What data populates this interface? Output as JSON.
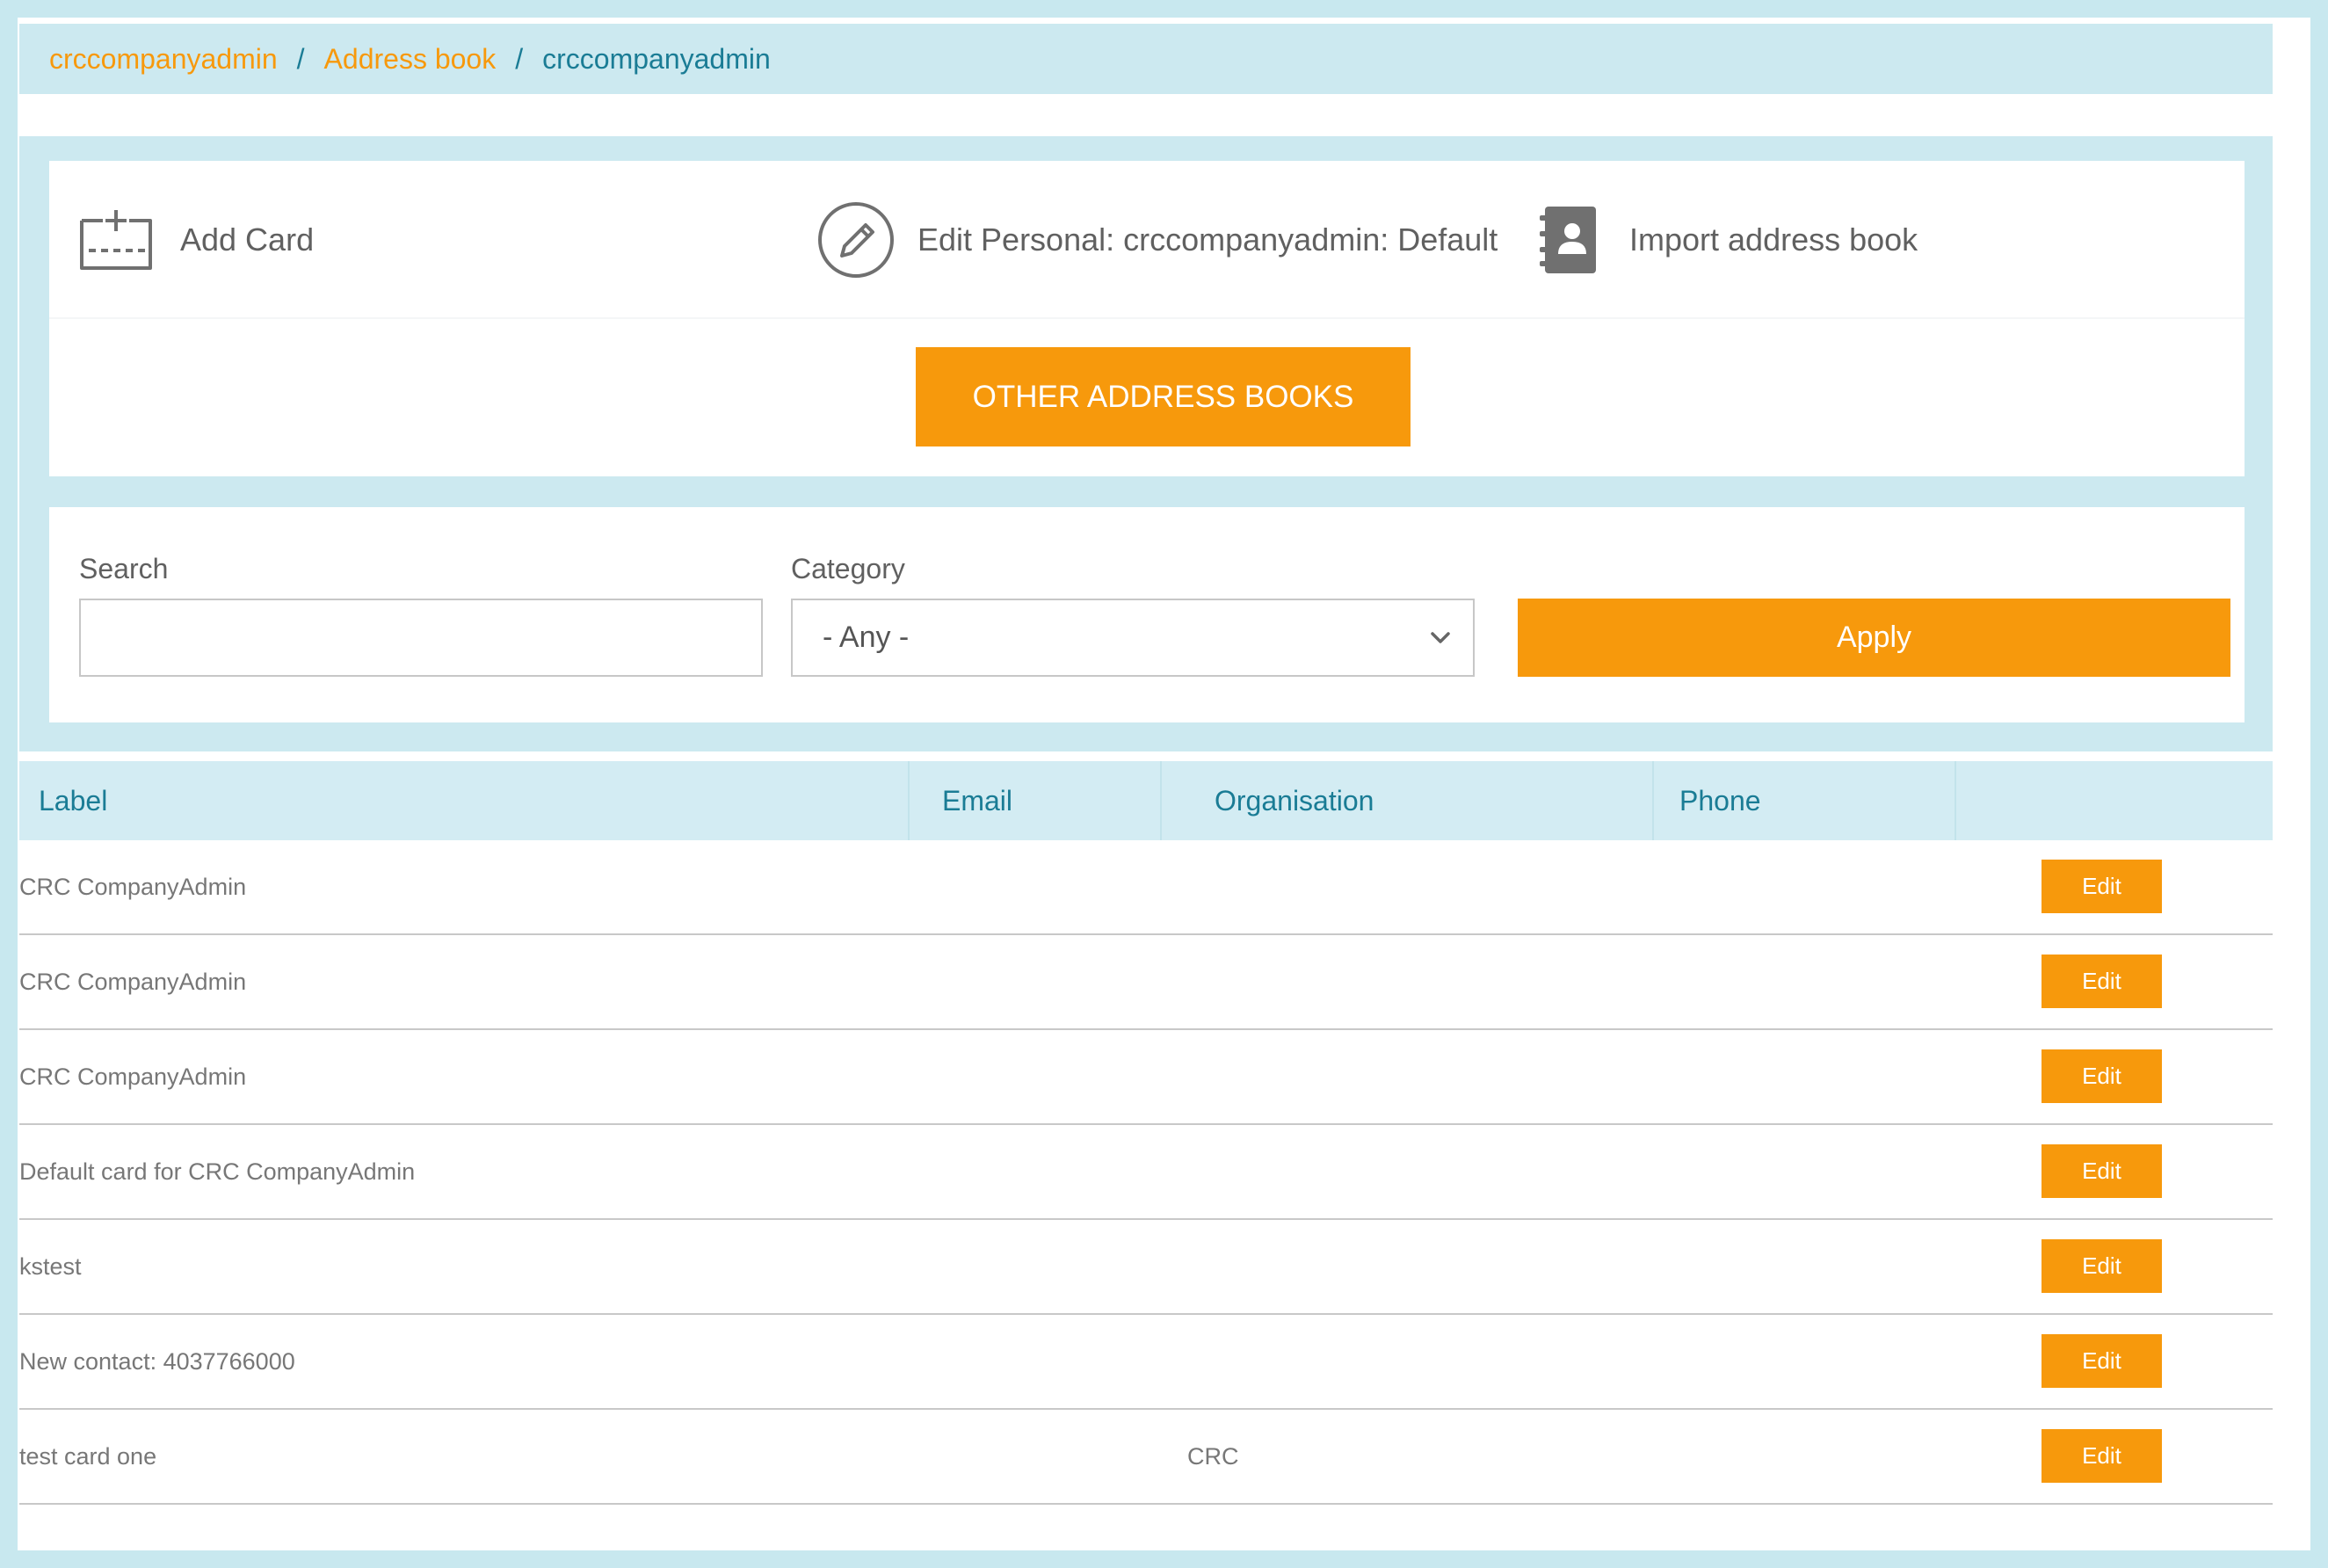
{
  "breadcrumb": {
    "items": [
      "crccompanyadmin",
      "Address book"
    ],
    "separator": "/",
    "current": "crccompanyadmin"
  },
  "actions": {
    "add_card": "Add Card",
    "edit_personal": "Edit Personal: crccompanyadmin: Default",
    "import_book": "Import address book"
  },
  "other_books_label": "OTHER ADDRESS BOOKS",
  "filters": {
    "search_label": "Search",
    "search_value": "",
    "category_label": "Category",
    "category_value": "- Any -",
    "apply_label": "Apply"
  },
  "table": {
    "columns": [
      "Label",
      "Email",
      "Organisation",
      "Phone"
    ],
    "edit_label": "Edit",
    "rows": [
      {
        "label": "CRC CompanyAdmin",
        "email": "",
        "organisation": "",
        "phone": ""
      },
      {
        "label": "CRC CompanyAdmin",
        "email": "",
        "organisation": "",
        "phone": ""
      },
      {
        "label": "CRC CompanyAdmin",
        "email": "",
        "organisation": "",
        "phone": ""
      },
      {
        "label": "Default card for CRC CompanyAdmin",
        "email": "",
        "organisation": "",
        "phone": ""
      },
      {
        "label": "kstest",
        "email": "",
        "organisation": "",
        "phone": ""
      },
      {
        "label": "New contact: 4037766000",
        "email": "",
        "organisation": "",
        "phone": ""
      },
      {
        "label": "test card one",
        "email": "",
        "organisation": "CRC",
        "phone": ""
      }
    ]
  },
  "colors": {
    "accent": "#f7990c",
    "link_teal": "#1a7c95",
    "panel_bg": "#cce9f0",
    "text_gray": "#606060"
  },
  "icons": {
    "add_card": "card-plus-icon",
    "edit_personal": "pencil-circle-icon",
    "import_book": "contact-book-icon",
    "select": "chevron-down-icon"
  }
}
